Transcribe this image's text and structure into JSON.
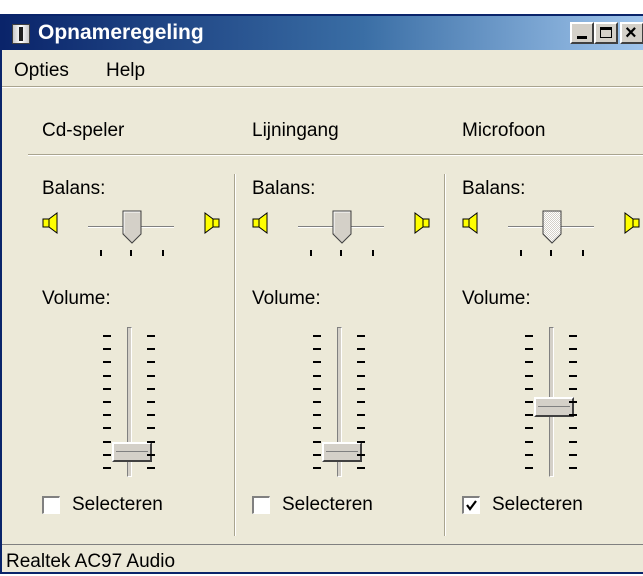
{
  "window": {
    "title": "Opnameregeling",
    "icon": "mixer-icon",
    "controls": [
      "minimize-icon",
      "maximize-icon",
      "close-icon"
    ],
    "close_glyph": "×"
  },
  "menu": [
    "Opties",
    "Help"
  ],
  "channels": [
    {
      "name": "Cd-speler",
      "balance_label": "Balans:",
      "balance_value": 0,
      "volume_label": "Volume:",
      "volume_level": 0.1,
      "select_label": "Selecteren",
      "selected": false
    },
    {
      "name": "Lijningang",
      "balance_label": "Balans:",
      "balance_value": 0,
      "volume_label": "Volume:",
      "volume_level": 0.1,
      "select_label": "Selecteren",
      "selected": false
    },
    {
      "name": "Microfoon",
      "balance_label": "Balans:",
      "balance_value": 0,
      "balance_disabled": true,
      "volume_label": "Volume:",
      "volume_level": 0.45,
      "select_label": "Selecteren",
      "selected": true
    }
  ],
  "status": "Realtek AC97 Audio",
  "colors": {
    "title_gradient_start": "#0a246a",
    "title_gradient_end": "#a6caf0",
    "face": "#ece9d8",
    "speaker": "#ffff00"
  }
}
